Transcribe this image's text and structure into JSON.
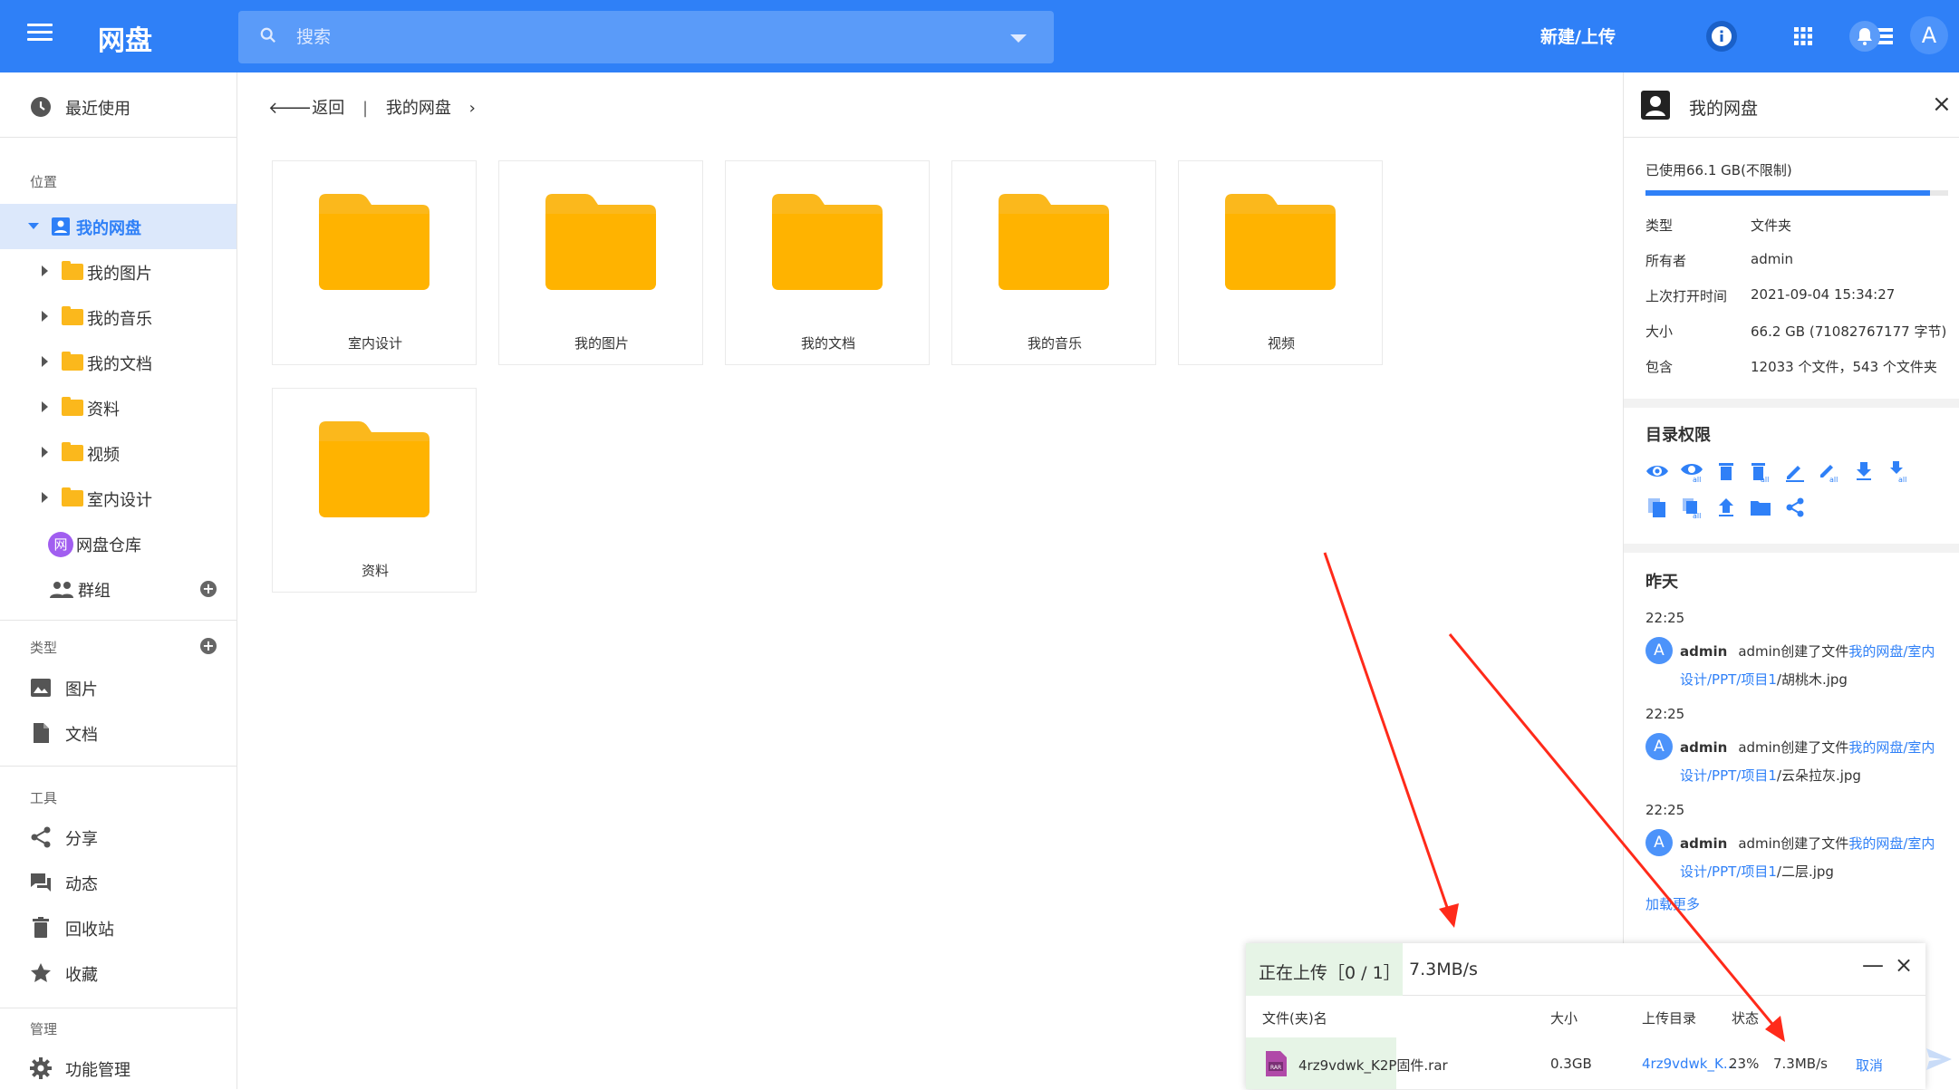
{
  "app": {
    "title": "网盘"
  },
  "search": {
    "placeholder": "搜索"
  },
  "header": {
    "new_upload": "新建/上传",
    "avatar_letter": "A"
  },
  "sidebar": {
    "recent": "最近使用",
    "location_heading": "位置",
    "my_drive": "我的网盘",
    "tree": [
      "我的图片",
      "我的音乐",
      "我的文档",
      "资料",
      "视频",
      "室内设计"
    ],
    "warehouse_badge": "网",
    "warehouse": "网盘仓库",
    "groups": "群组",
    "types_heading": "类型",
    "types": [
      "图片",
      "文档"
    ],
    "tools_heading": "工具",
    "tools": [
      "分享",
      "动态",
      "回收站",
      "收藏"
    ],
    "admin_heading": "管理",
    "admin": [
      "功能管理"
    ]
  },
  "breadcrumb": {
    "back": "返回",
    "separator": "|",
    "current": "我的网盘",
    "chevron": "›"
  },
  "folders": [
    "室内设计",
    "我的图片",
    "我的文档",
    "我的音乐",
    "视频",
    "资料"
  ],
  "info_panel": {
    "title": "我的网盘",
    "close": "×",
    "used": "已使用66.1 GB(不限制)",
    "usage_fraction": 0.94,
    "props": [
      {
        "k": "类型",
        "v": "文件夹"
      },
      {
        "k": "所有者",
        "v": "admin"
      },
      {
        "k": "上次打开时间",
        "v": "2021-09-04 15:34:27"
      },
      {
        "k": "大小",
        "v": "66.2 GB (71082767177 字节)"
      },
      {
        "k": "包含",
        "v": "12033 个文件，543 个文件夹"
      }
    ],
    "perm_heading": "目录权限",
    "activity_heading": "昨天",
    "activities": [
      {
        "time": "22:25",
        "avatar": "A",
        "user": "admin",
        "action": "admin创建了文件",
        "path1": "我的网盘/室内",
        "path2": "设计/PPT/项目1",
        "file": "/胡桃木.jpg"
      },
      {
        "time": "22:25",
        "avatar": "A",
        "user": "admin",
        "action": "admin创建了文件",
        "path1": "我的网盘/室内",
        "path2": "设计/PPT/项目1",
        "file": "/云朵拉灰.jpg"
      },
      {
        "time": "22:25",
        "avatar": "A",
        "user": "admin",
        "action": "admin创建了文件",
        "path1": "我的网盘/室内",
        "path2": "设计/PPT/项目1",
        "file": "/二层.jpg"
      }
    ],
    "load_more": "加载更多"
  },
  "upload": {
    "status": "正在上传［0 / 1］",
    "speed": "7.3MB/s",
    "minimize": "—",
    "close": "×",
    "columns": {
      "name": "文件(夹)名",
      "size": "大小",
      "dir": "上传目录",
      "state": "状态"
    },
    "row": {
      "name": "4rz9vdwk_K2P固件.rar",
      "size": "0.3GB",
      "dir": "4rz9vdwk_K...",
      "percent": "23%",
      "speed": "7.3MB/s",
      "cancel": "取消"
    }
  },
  "colors": {
    "primary": "#2f80f7",
    "folder": "#fbb81c",
    "annotation": "#ff2a1a"
  }
}
